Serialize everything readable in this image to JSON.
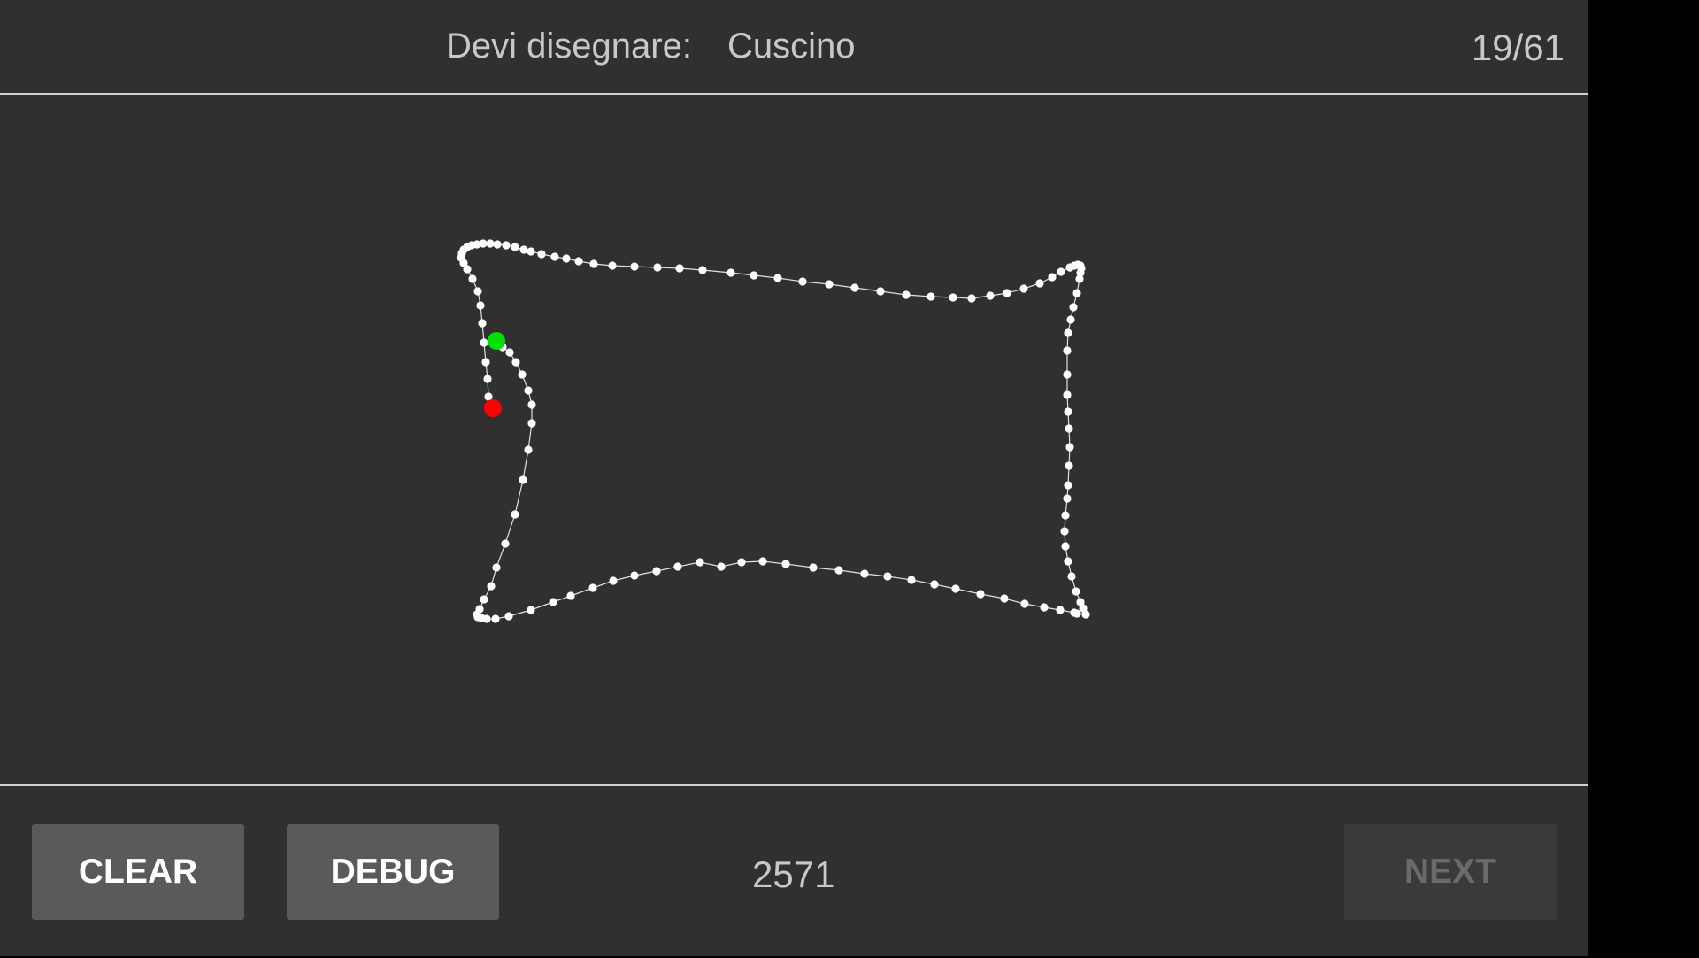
{
  "header": {
    "prompt_label": "Devi disegnare:",
    "word": "Cuscino",
    "progress": "19/61"
  },
  "footer": {
    "clear_label": "CLEAR",
    "debug_label": "DEBUG",
    "score": "2571",
    "next_label": "NEXT",
    "next_enabled": false
  },
  "colors": {
    "background": "#303030",
    "stroke": "#ffffff",
    "start_point": "#00e000",
    "end_point": "#ff0000"
  }
}
